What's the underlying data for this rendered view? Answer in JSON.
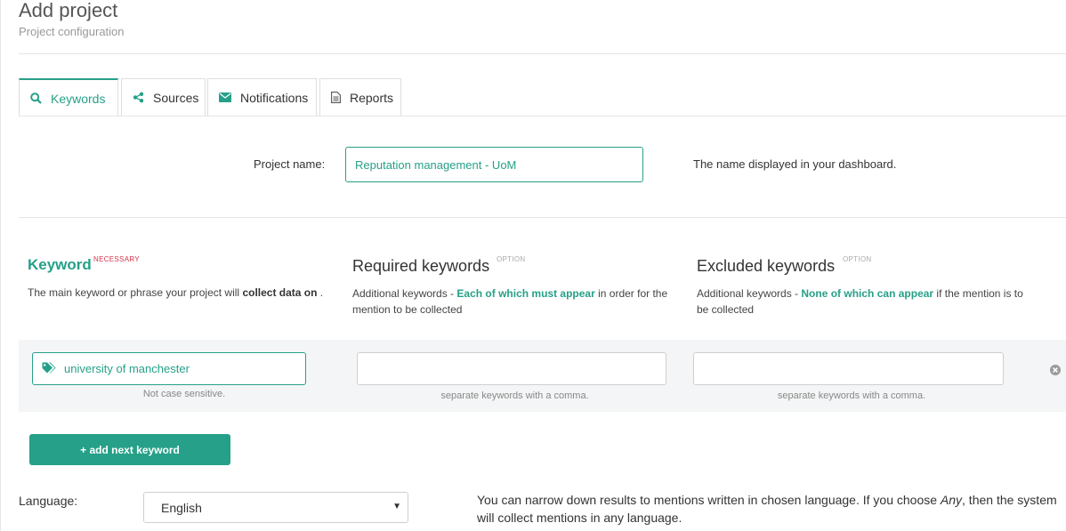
{
  "header": {
    "title": "Add project",
    "subtitle": "Project configuration"
  },
  "tabs": [
    {
      "label": "Keywords",
      "icon": "search-icon",
      "active": true
    },
    {
      "label": "Sources",
      "icon": "share-icon",
      "active": false
    },
    {
      "label": "Notifications",
      "icon": "envelope-icon",
      "active": false
    },
    {
      "label": "Reports",
      "icon": "document-icon",
      "active": false
    }
  ],
  "project_name": {
    "label": "Project name:",
    "value": "Reputation management - UoM",
    "help": "The name displayed in your dashboard."
  },
  "keyword": {
    "heading": "Keyword",
    "badge": "NECESSARY",
    "desc_pre": "The main keyword or phrase your project will ",
    "desc_bold": "collect data on",
    "desc_post": " .",
    "value": "university of manchester",
    "hint": "Not case sensitive."
  },
  "required": {
    "heading": "Required keywords",
    "badge": "OPTION",
    "desc_pre": "Additional keywords - ",
    "desc_hl": "Each of which must appear",
    "desc_post": " in order for the mention to be collected",
    "value": "",
    "hint": "separate keywords with a comma."
  },
  "excluded": {
    "heading": "Excluded keywords",
    "badge": "OPTION",
    "desc_pre": "Additional keywords - ",
    "desc_hl": "None of which can appear",
    "desc_post": " if the mention is to be collected",
    "value": "",
    "hint": "separate keywords with a comma."
  },
  "add_button": "+ add next keyword",
  "language": {
    "label": "Language:",
    "selected": "English",
    "help_pre": "You can narrow down results to mentions written in chosen language. If you choose ",
    "help_em": "Any",
    "help_post": ", then the system will collect mentions in any language."
  },
  "colors": {
    "accent": "#26a088",
    "necessary": "#d6334a",
    "band": "#f4f5f6"
  }
}
